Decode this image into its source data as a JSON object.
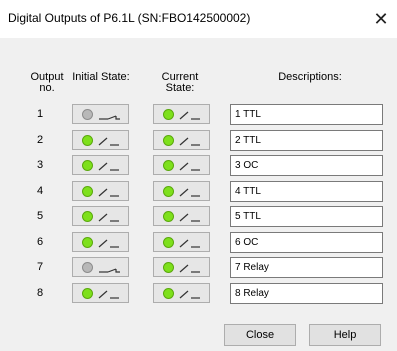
{
  "window": {
    "title": "Digital Outputs of P6.1L (SN:FBO142500002)",
    "close_glyph": "✕"
  },
  "headers": {
    "output_no_line1": "Output",
    "output_no_line2": "no.",
    "initial_state": "Initial State:",
    "current_state_line1": "Current",
    "current_state_line2": "State:",
    "descriptions": "Descriptions:"
  },
  "rows": [
    {
      "no": "1",
      "initial": "open",
      "current": "closed",
      "description": "1 TTL"
    },
    {
      "no": "2",
      "initial": "closed",
      "current": "closed",
      "description": "2 TTL"
    },
    {
      "no": "3",
      "initial": "closed",
      "current": "closed",
      "description": "3 OC"
    },
    {
      "no": "4",
      "initial": "closed",
      "current": "closed",
      "description": "4 TTL"
    },
    {
      "no": "5",
      "initial": "closed",
      "current": "closed",
      "description": "5 TTL"
    },
    {
      "no": "6",
      "initial": "closed",
      "current": "closed",
      "description": "6 OC"
    },
    {
      "no": "7",
      "initial": "open",
      "current": "closed",
      "description": "7 Relay"
    },
    {
      "no": "8",
      "initial": "closed",
      "current": "closed",
      "description": "8 Relay"
    }
  ],
  "buttons": {
    "close": "Close",
    "help": "Help"
  },
  "colors": {
    "led_on": "#7ee01c",
    "led_off": "#b8b8b8"
  }
}
